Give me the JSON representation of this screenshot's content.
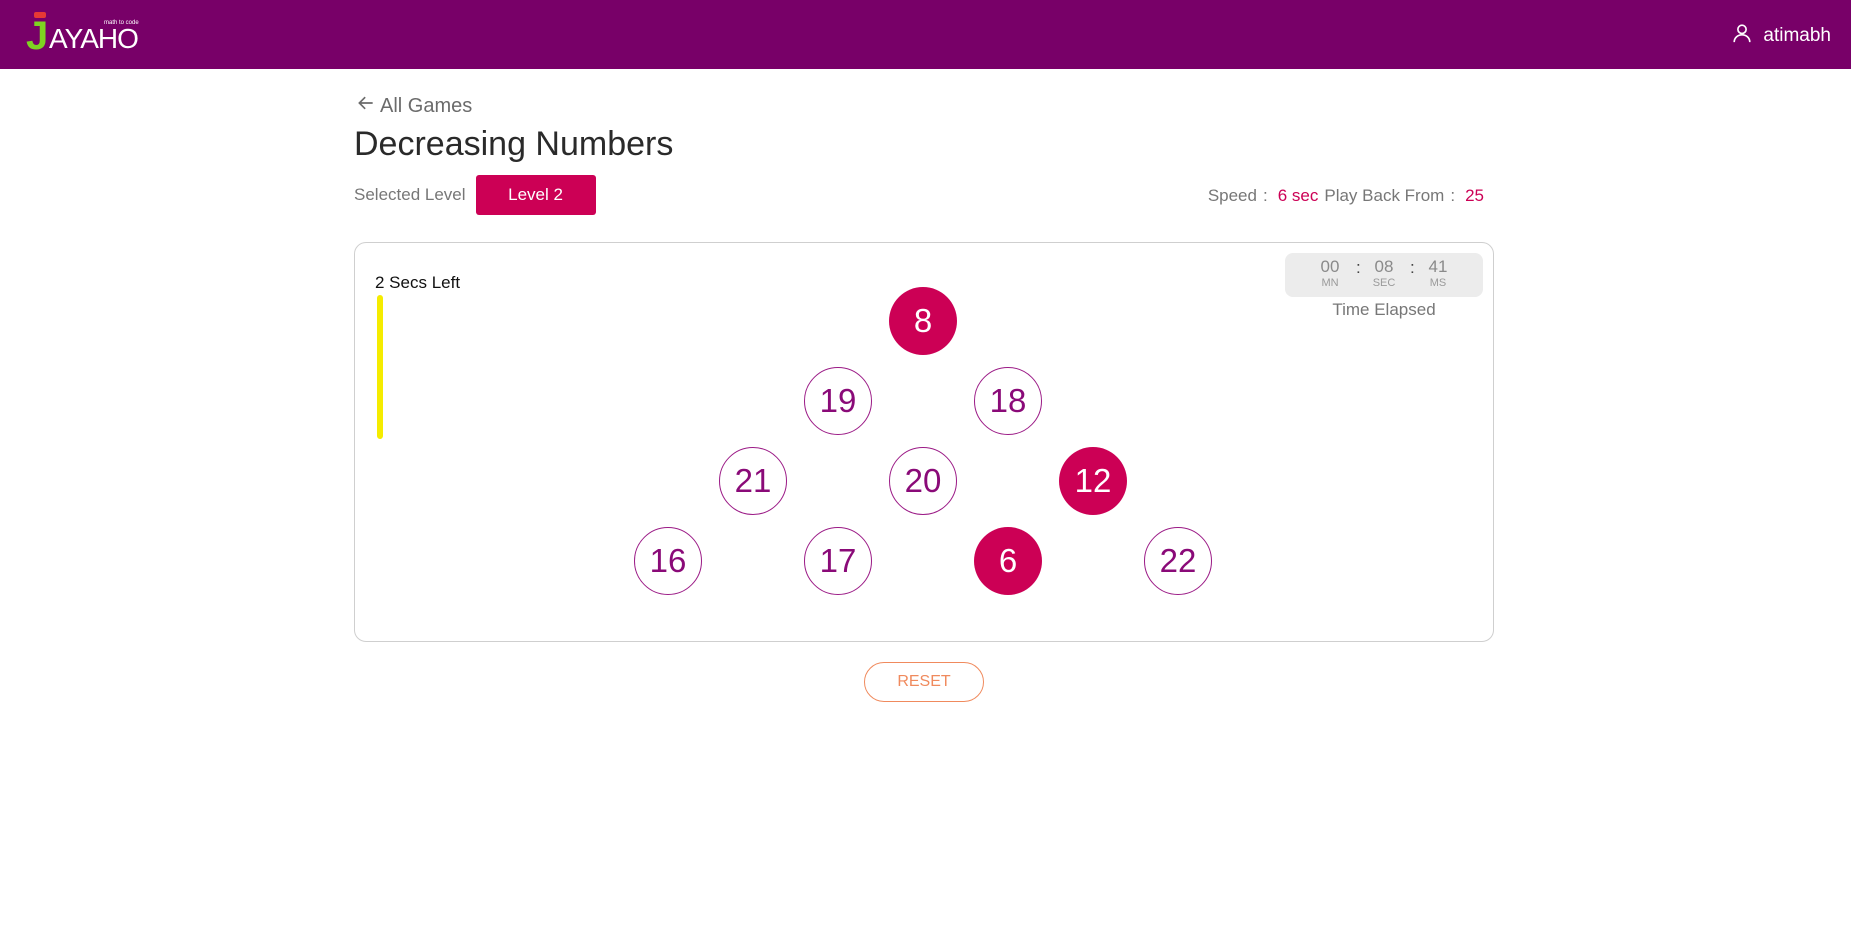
{
  "header": {
    "logo_text": "JAYAHO",
    "logo_tagline": "math to code",
    "username": "atimabh",
    "user_icon": "user-icon"
  },
  "nav": {
    "back_label": "All Games",
    "back_icon": "arrow-left-icon"
  },
  "page": {
    "title": "Decreasing Numbers",
    "level_label": "Selected Level",
    "level_value": "Level 2",
    "speed_label": "Speed",
    "speed_value": "6 sec",
    "playback_label": "Play Back From",
    "playback_value": "25",
    "colon": ":"
  },
  "game": {
    "secs_left": "2 Secs Left",
    "timer": {
      "minutes": "00",
      "minutes_unit": "MN",
      "seconds": "08",
      "seconds_unit": "SEC",
      "ms": "41",
      "ms_unit": "MS",
      "label": "Time Elapsed"
    },
    "balls": [
      {
        "value": "8",
        "state": "filled"
      },
      {
        "value": "19",
        "state": "outline"
      },
      {
        "value": "18",
        "state": "outline"
      },
      {
        "value": "21",
        "state": "outline"
      },
      {
        "value": "20",
        "state": "outline"
      },
      {
        "value": "12",
        "state": "filled"
      },
      {
        "value": "16",
        "state": "outline"
      },
      {
        "value": "17",
        "state": "outline"
      },
      {
        "value": "6",
        "state": "filled"
      },
      {
        "value": "22",
        "state": "outline"
      }
    ]
  },
  "controls": {
    "reset_label": "RESET"
  },
  "colors": {
    "topbar": "#780068",
    "accent": "#cc0055",
    "ball_outline": "#9b1a86",
    "timer_bar": "#f5ec00",
    "reset": "#f08a5d"
  }
}
